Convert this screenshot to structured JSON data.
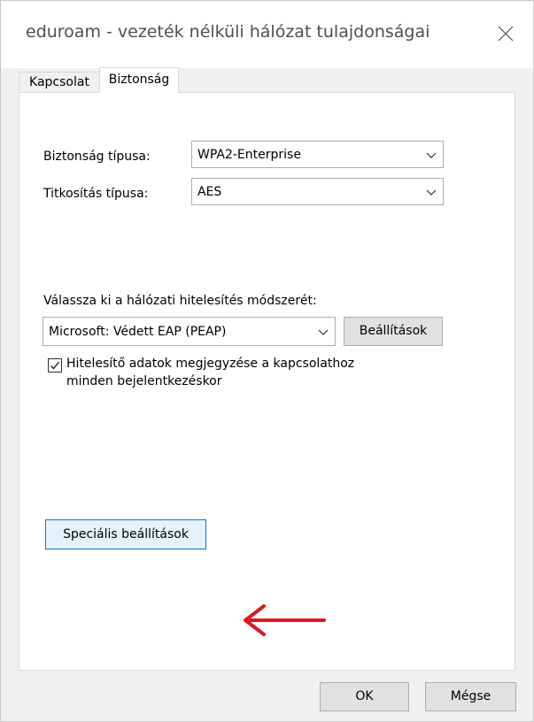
{
  "window": {
    "title": "eduroam - vezeték nélküli hálózat tulajdonságai",
    "close_icon": "close-icon"
  },
  "tabs": [
    {
      "label": "Kapcsolat",
      "active": false
    },
    {
      "label": "Biztonság",
      "active": true
    }
  ],
  "security": {
    "type_label": "Biztonság típusa:",
    "type_value": "WPA2-Enterprise",
    "encryption_label": "Titkosítás típusa:",
    "encryption_value": "AES"
  },
  "auth": {
    "method_label": "Válassza ki a hálózati hitelesítés módszerét:",
    "method_value": "Microsoft: Védett EAP (PEAP)",
    "settings_button": "Beállítások",
    "remember_checked": true,
    "remember_label_line1": "Hitelesítő adatok megjegyzése a kapcsolathoz",
    "remember_label_line2": "minden bejelentkezéskor"
  },
  "advanced_button": "Speciális beállítások",
  "annotation": {
    "arrow_color": "#e8141b",
    "icon": "red-arrow-left-icon"
  },
  "footer": {
    "ok_button": "OK",
    "cancel_button": "Mégse"
  },
  "colors": {
    "accent": "#0078d7",
    "annotation": "#e8141b"
  }
}
